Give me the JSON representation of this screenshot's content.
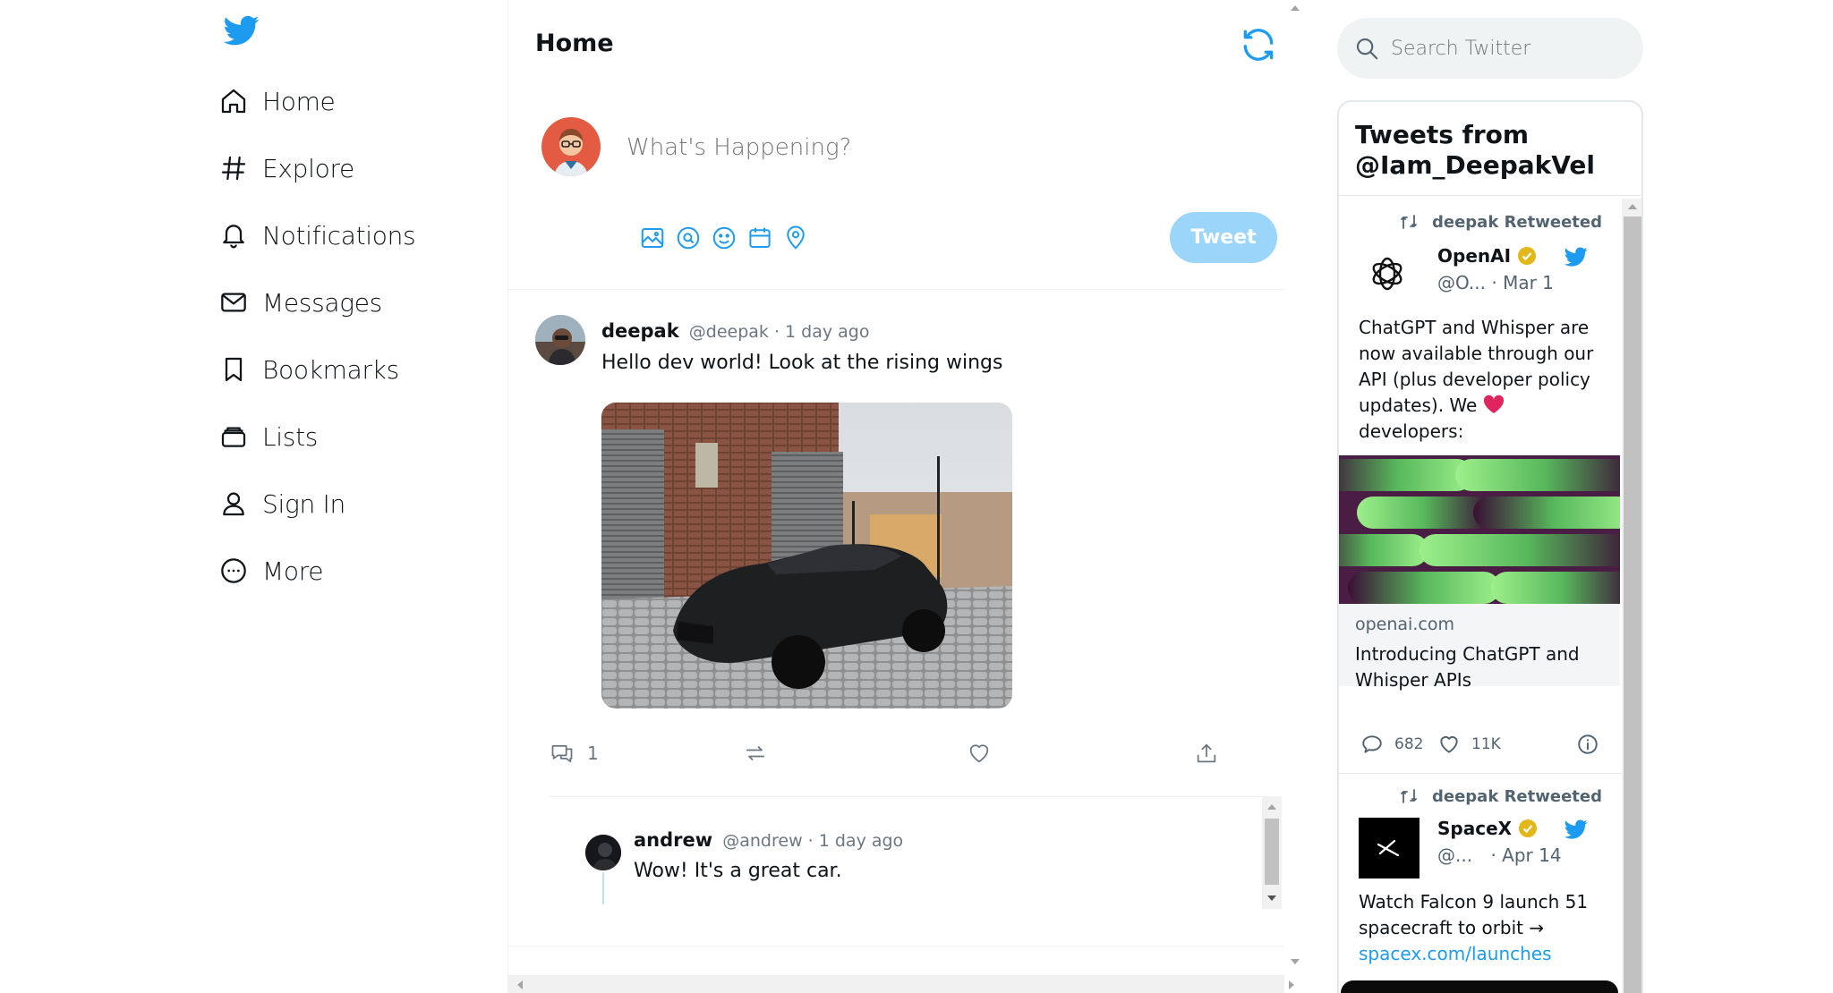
{
  "colors": {
    "brand": "#1d9bf0",
    "tweet_button_disabled": "#9bd5fa",
    "text": "#0f1419",
    "muted": "#6b7780"
  },
  "nav": {
    "items": [
      {
        "label": "Home",
        "icon": "home-icon"
      },
      {
        "label": "Explore",
        "icon": "hashtag-icon"
      },
      {
        "label": "Notifications",
        "icon": "bell-icon"
      },
      {
        "label": "Messages",
        "icon": "envelope-icon"
      },
      {
        "label": "Bookmarks",
        "icon": "bookmark-icon"
      },
      {
        "label": "Lists",
        "icon": "list-icon"
      },
      {
        "label": "Sign In",
        "icon": "user-icon"
      },
      {
        "label": "More",
        "icon": "more-circle-icon"
      }
    ]
  },
  "main": {
    "title": "Home",
    "compose": {
      "placeholder": "What's Happening?",
      "tweet_button": "Tweet"
    },
    "post": {
      "name": "deepak",
      "meta": "@deepak · 1 day ago",
      "text": "Hello dev world! Look at the rising wings",
      "reply_count": "1"
    },
    "reply": {
      "name": "andrew",
      "meta": "@andrew · 1 day ago",
      "text": "Wow! It's a great car."
    }
  },
  "search": {
    "placeholder": "Search Twitter"
  },
  "timeline": {
    "title_line1": "Tweets from",
    "title_line2": "@Iam_DeepakVel",
    "tweets": [
      {
        "retweet_label": "deepak Retweeted",
        "name": "OpenAI",
        "handle": "@O...",
        "date": "· Mar 1",
        "text": "ChatGPT and Whisper are now available through our API (plus developer policy updates). We",
        "text_end": "developers:",
        "card_domain": "openai.com",
        "card_title": "Introducing ChatGPT and Whisper APIs",
        "replies": "682",
        "likes": "11K"
      },
      {
        "retweet_label": "deepak Retweeted",
        "name": "SpaceX",
        "handle": "@...",
        "date": "· Apr 14",
        "text": "Watch Falcon 9 launch 51 spacecraft to orbit →",
        "link": "spacex.com/launches"
      }
    ]
  }
}
